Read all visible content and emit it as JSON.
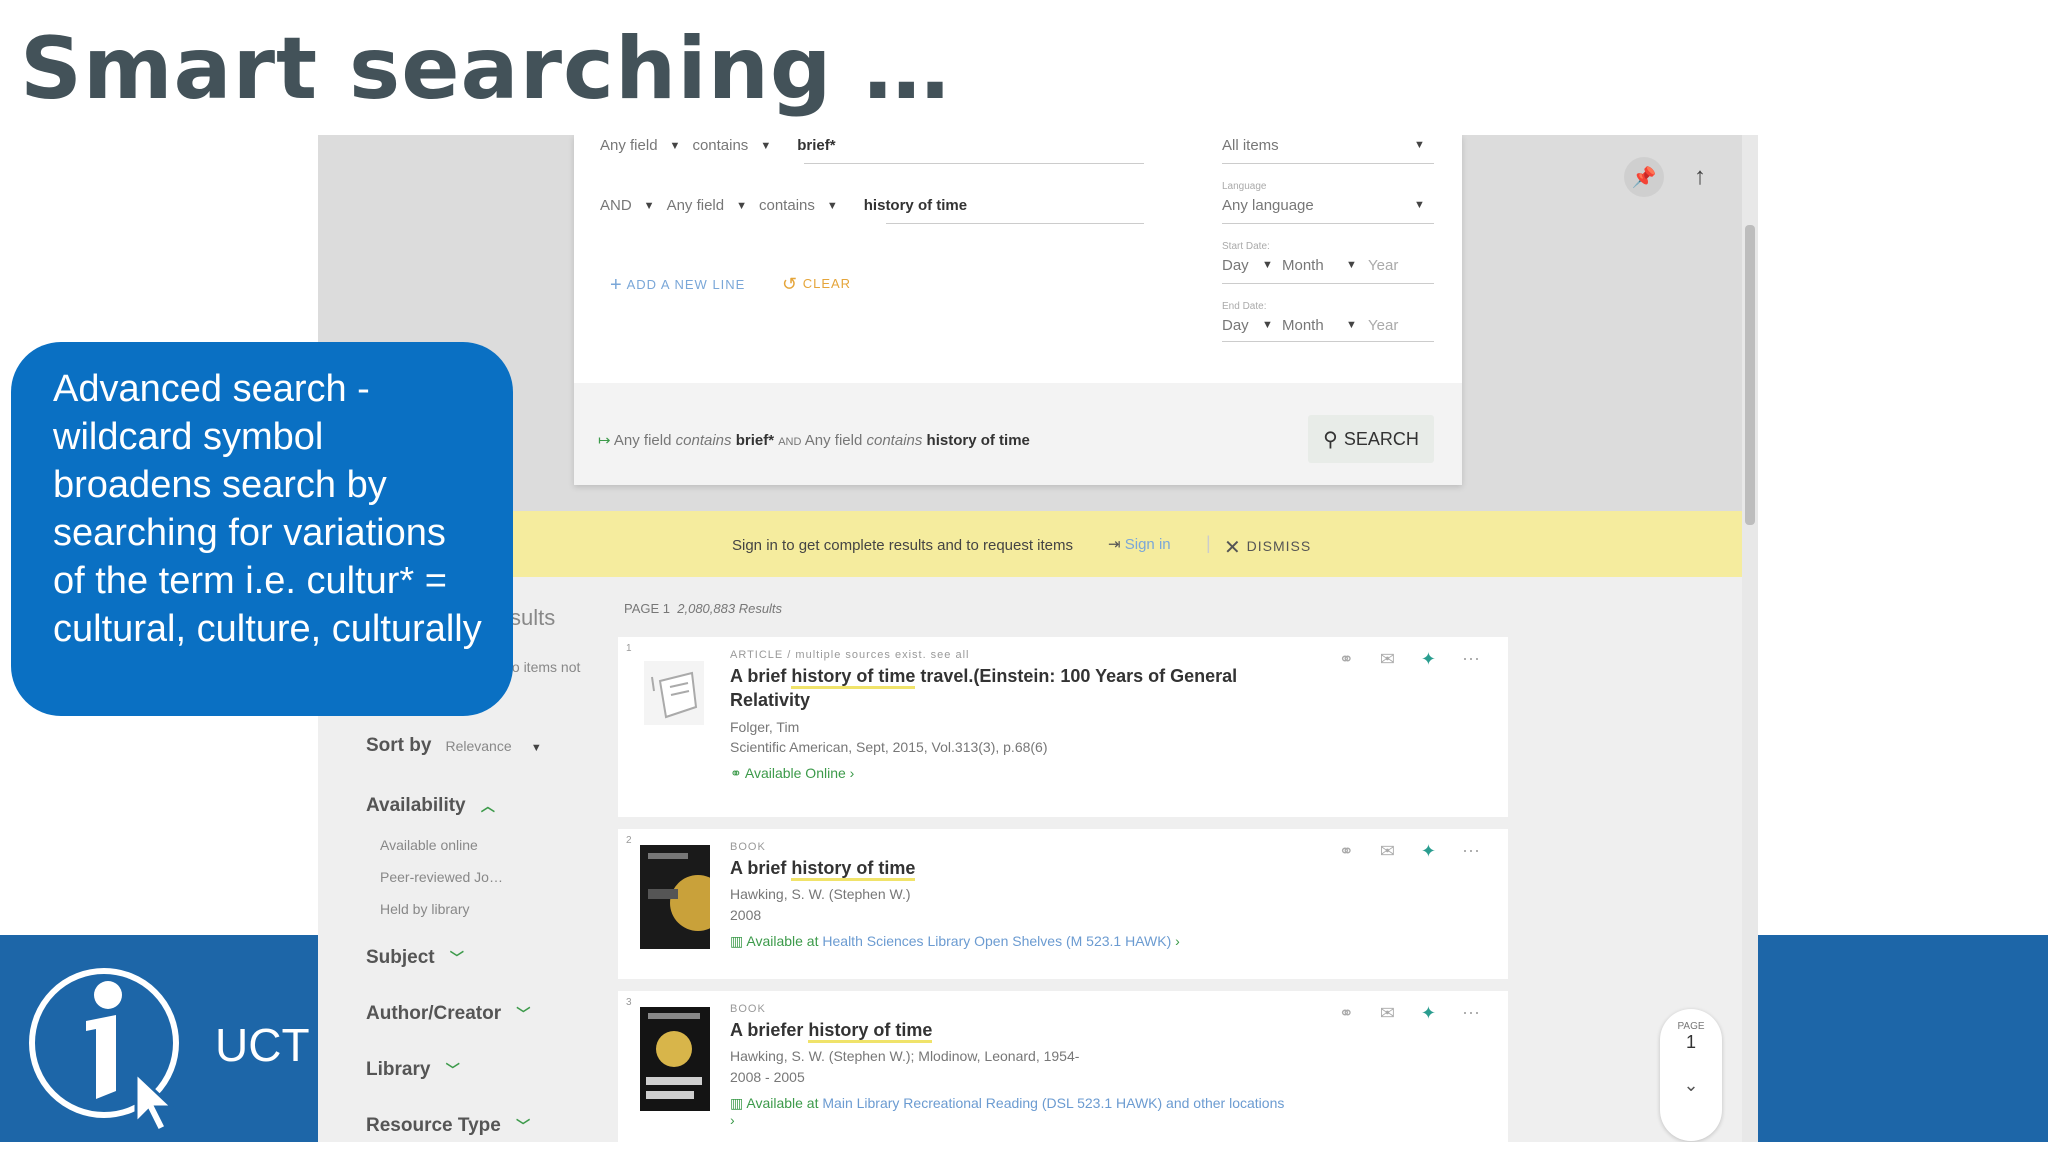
{
  "slide": {
    "title": "Smart searching …",
    "footer_text": "UCT L",
    "callout": "Advanced search - wildcard symbol broadens search by searching for variations of the term i.e. cultur* = cultural, culture, culturally"
  },
  "colors": {
    "title": "#435259",
    "footer_band": "#1d66a8",
    "callout_bg": "#0a70c3",
    "signin_bar": "#f5ec9e",
    "highlight": "#f0e36a",
    "available": "#3c9a4a"
  },
  "advanced_search": {
    "row1": {
      "field": "Any field",
      "operator": "contains",
      "term": "brief*"
    },
    "row2": {
      "boolean": "AND",
      "field": "Any field",
      "operator": "contains",
      "term": "history of time"
    },
    "material_type": "All items",
    "language_label": "Language",
    "language_value": "Any language",
    "start_date_label": "Start Date:",
    "end_date_label": "End Date:",
    "day": "Day",
    "month": "Month",
    "year": "Year",
    "add_line": "ADD A NEW LINE",
    "clear": "CLEAR",
    "summary": {
      "f1": "Any field",
      "op1": "contains",
      "t1": "brief*",
      "bool": "AND",
      "f2": "Any field",
      "op2": "contains",
      "t2": "history of time"
    },
    "search_button": "SEARCH"
  },
  "signin_bar": {
    "message": "Sign in to get complete results and to request items",
    "signin": "Sign in",
    "dismiss": "DISMISS"
  },
  "facets": {
    "partial_results": "sults",
    "partial_items": "to items not",
    "sort_label": "Sort by",
    "sort_value": "Relevance",
    "availability": "Availability",
    "availability_options": [
      "Available online",
      "Peer-reviewed Jo…",
      "Held by library"
    ],
    "subject": "Subject",
    "author": "Author/Creator",
    "library": "Library",
    "resource_type": "Resource Type"
  },
  "results": {
    "page_label": "PAGE 1",
    "count": "2,080,883 Results",
    "items": [
      {
        "num": "1",
        "type": "ARTICLE / multiple sources exist. see all",
        "title_pre": "A brief ",
        "title_hl": "history of time",
        "title_post": " travel.(Einstein: 100 Years of General Relativity",
        "author": "Folger, Tim",
        "source": "Scientific American, Sept, 2015, Vol.313(3), p.68(6)",
        "avail": "Available Online",
        "avail_loc": ""
      },
      {
        "num": "2",
        "type": "BOOK",
        "title_pre": "A brief ",
        "title_hl": "history of time",
        "title_post": "",
        "author": "Hawking, S. W. (Stephen W.)",
        "source": "2008",
        "avail": "Available at",
        "avail_loc": "Health Sciences Library  Open Shelves (M 523.1 HAWK)"
      },
      {
        "num": "3",
        "type": "BOOK",
        "title_pre": "A briefer ",
        "title_hl": "history of time",
        "title_post": "",
        "author": "Hawking, S. W. (Stephen W.); Mlodinow, Leonard, 1954-",
        "source": "2008 - 2005",
        "avail": "Available at",
        "avail_loc": "Main Library  Recreational Reading (DSL 523.1 HAWK)  and other locations"
      }
    ]
  },
  "pager": {
    "label": "PAGE",
    "number": "1"
  }
}
